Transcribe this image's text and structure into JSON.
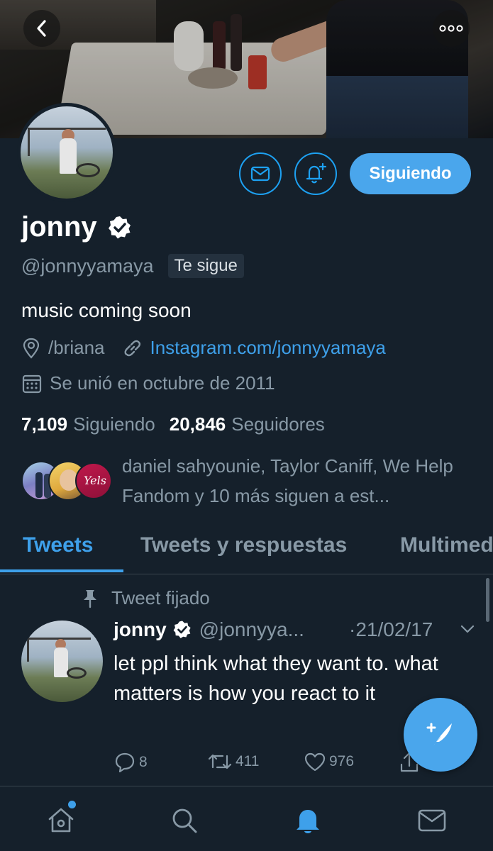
{
  "colors": {
    "background": "#15202b",
    "accent": "#1da1f2",
    "secondary_text": "#8899a6",
    "divider": "#38444d"
  },
  "header": {
    "back_icon": "chevron-left-icon",
    "more_icon": "more-dots-icon"
  },
  "profile": {
    "name": "jonny",
    "handle": "@jonnyyamaya",
    "follows_you_badge": "Te sigue",
    "bio": "music coming soon",
    "location": "/briana",
    "website": "Instagram.com/jonnyyamaya",
    "joined": "Se unió en octubre de 2011",
    "following_count": "7,109",
    "following_label": "Siguiendo",
    "followers_count": "20,846",
    "followers_label": "Seguidores",
    "followed_by_text": "daniel sahyounie, Taylor Caniff, We Help Fandom y 10 más siguen a est..."
  },
  "actions": {
    "message_icon": "envelope-icon",
    "notify_icon": "bell-plus-icon",
    "follow_button_label": "Siguiendo"
  },
  "tabs": [
    {
      "label": "Tweets",
      "active": true
    },
    {
      "label": "Tweets y respuestas",
      "active": false
    },
    {
      "label": "Multimedia",
      "active": false
    }
  ],
  "pinned_tweet": {
    "pinned_label": "Tweet fijado",
    "author_name": "jonny",
    "author_handle": "@jonnyya...",
    "date": "·21/02/17",
    "text": "let ppl think what they want to. what matters is how you react to it",
    "reply_count": "8",
    "retweet_count": "411",
    "like_count": "976"
  },
  "compose_fab_icon": "compose-feather-icon",
  "bottom_nav": [
    {
      "name": "home",
      "icon": "home-icon",
      "has_badge": true
    },
    {
      "name": "search",
      "icon": "search-icon",
      "has_badge": false
    },
    {
      "name": "notifications",
      "icon": "bell-icon",
      "active": true
    },
    {
      "name": "messages",
      "icon": "envelope-icon",
      "has_badge": false
    }
  ]
}
